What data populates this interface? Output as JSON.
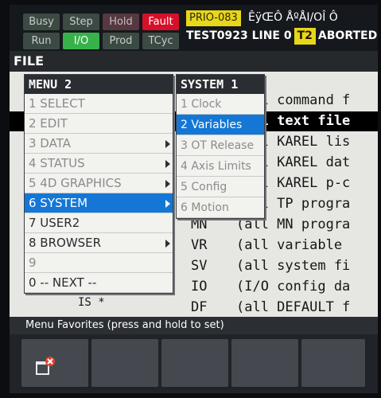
{
  "status": {
    "busy": "Busy",
    "step": "Step",
    "hold": "Hold",
    "fault": "Fault",
    "run": "Run",
    "io": "I/O",
    "prod": "Prod",
    "tcyc": "TCyc",
    "prio": "PRIO-083",
    "garbled": "ÊÿŒÔ ÅºÅI/OÎ  Ô",
    "program": "TEST0923 LINE 0",
    "mode": "T2",
    "state": "ABORTED"
  },
  "screen_title": "FILE",
  "file_rows": [
    {
      "code": "",
      "desc": "(all command f"
    },
    {
      "code": "",
      "desc": "(all text file"
    },
    {
      "code": "",
      "desc": "(all KAREL lis"
    },
    {
      "code": "",
      "desc": "(all KAREL dat"
    },
    {
      "code": "",
      "desc": "(all KAREL p-c"
    },
    {
      "code": "",
      "desc": "(all TP progra"
    },
    {
      "code": "MN",
      "desc": "(all MN progra"
    },
    {
      "code": "VR",
      "desc": "(all variable"
    },
    {
      "code": "SV",
      "desc": "(all system fi"
    },
    {
      "code": "IO",
      "desc": "(I/O config da"
    },
    {
      "code": "DF",
      "desc": "(all DEFAULT f"
    }
  ],
  "hidden_code": "IS *",
  "menu": {
    "title": "MENU  2",
    "items": [
      {
        "label": "1 SELECT"
      },
      {
        "label": "2 EDIT"
      },
      {
        "label": "3 DATA"
      },
      {
        "label": "4 STATUS"
      },
      {
        "label": "5 4D GRAPHICS"
      },
      {
        "label": "6 SYSTEM"
      },
      {
        "label": "7 USER2"
      },
      {
        "label": "8 BROWSER"
      },
      {
        "label": "9"
      },
      {
        "label": "0 -- NEXT --"
      }
    ]
  },
  "submenu": {
    "title": "SYSTEM  1",
    "items": [
      {
        "label": "1 Clock"
      },
      {
        "label": "2 Variables"
      },
      {
        "label": "3 OT Release"
      },
      {
        "label": "4 Axis Limits"
      },
      {
        "label": "5 Config"
      },
      {
        "label": "6 Motion"
      }
    ]
  },
  "favorites_label": "Menu Favorites (press and hold to set)",
  "colors": {
    "accent": "#1477d6",
    "fault": "#d7102a",
    "io_on": "#37b24a",
    "warning": "#e8d61a"
  },
  "icons": {
    "favorite_key": "window-close-badge-icon",
    "submenu": "chevron-right-icon"
  }
}
